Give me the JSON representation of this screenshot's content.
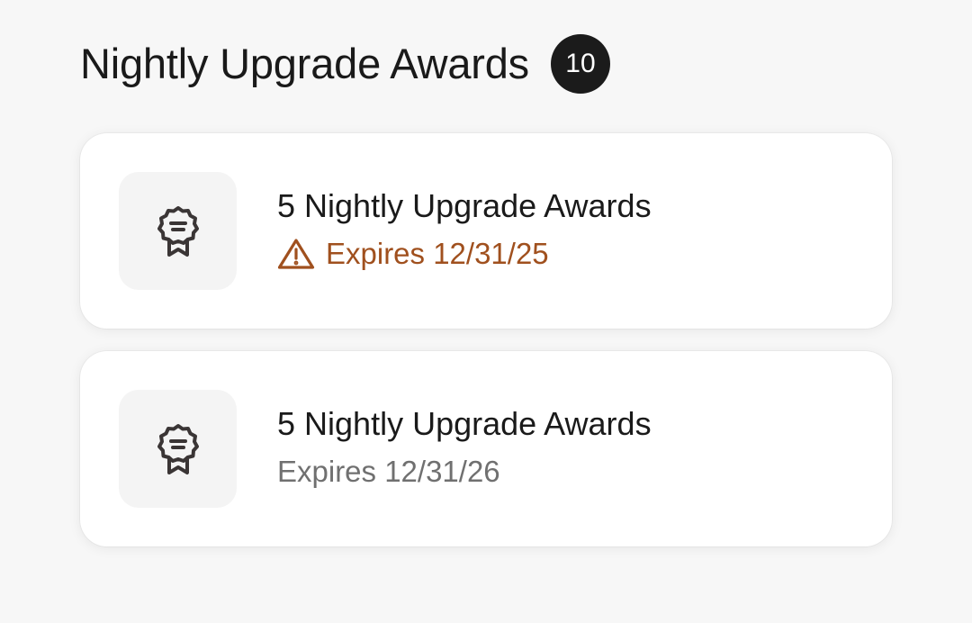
{
  "header": {
    "title": "Nightly Upgrade Awards",
    "count": "10"
  },
  "colors": {
    "warning": "#a0501e",
    "muted": "#707070",
    "badge_bg": "#1b1b1b"
  },
  "awards": [
    {
      "title": "5 Nightly Upgrade Awards",
      "expiry": "Expires 12/31/25",
      "status": "warning",
      "icon": "award-ribbon-icon",
      "status_icon": "warning-triangle-icon"
    },
    {
      "title": "5 Nightly Upgrade Awards",
      "expiry": "Expires 12/31/26",
      "status": "normal",
      "icon": "award-ribbon-icon"
    }
  ]
}
